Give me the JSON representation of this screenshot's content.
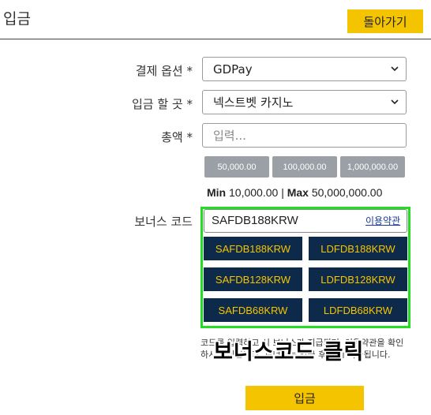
{
  "header": {
    "title": "입금",
    "back_label": "돌아가기"
  },
  "form": {
    "payment_option": {
      "label": "결제 옵션 *",
      "value": "GDPay"
    },
    "deposit_to": {
      "label": "입금 할 곳 *",
      "value": "넥스트벳 카지노"
    },
    "amount": {
      "label": "총액 *",
      "placeholder": "입력..."
    },
    "quick_amounts": [
      "50,000.00",
      "100,000.00",
      "1,000,000.00"
    ],
    "limits": {
      "min_label": "Min",
      "min_value": "10,000.00",
      "separator": "|",
      "max_label": "Max",
      "max_value": "50,000,000.00"
    },
    "bonus": {
      "label": "보너스 코드",
      "value": "SAFDB188KRW",
      "terms_link": "이용약관",
      "codes": [
        "SAFDB188KRW",
        "LDFDB188KRW",
        "SAFDB128KRW",
        "LDFDB128KRW",
        "SAFDB68KRW",
        "LDFDB68KRW"
      ]
    },
    "notice": "코드를 입력하고 시 보너스가 지급되며, 이용약관을 확인하시기 바랍니다. 보너스는 입금 후 즉시 지급됩니다.",
    "overlay_caption": "보너스코드 클릭",
    "submit_label": "입금"
  },
  "colors": {
    "accent": "#f5c400",
    "navy": "#0e2a4a",
    "highlight": "#22dd22",
    "quick_btn": "#9aa0a6"
  }
}
